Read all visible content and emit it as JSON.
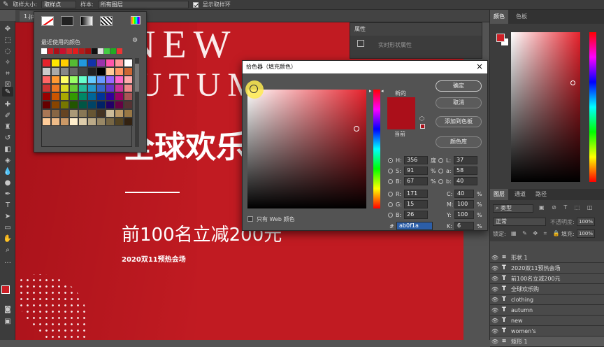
{
  "options_bar": {
    "sample_size_label": "取样大小:",
    "sample_size_value": "取样点",
    "sample_label": "样本:",
    "sample_value": "所有图层",
    "show_ring_label": "显示取样环"
  },
  "document": {
    "tab_name": "1.jpg"
  },
  "canvas": {
    "line1": "NEW",
    "line2": "AUTUMN",
    "headline": "全球欢乐购",
    "promo": "前100名立减200元",
    "event": "2020双11预热会场"
  },
  "swatches_panel": {
    "recent_label": "最近使用的颜色",
    "recent": [
      "#ffffff",
      "#cc1f26",
      "#ab0f1a",
      "#c8102e",
      "#d42a2a",
      "#e41a1c",
      "#b31b1b",
      "#a01010",
      "#111111",
      "#e0e0e0",
      "#44cc44",
      "#22aa22",
      "#ee3333"
    ],
    "grid": [
      "#e6222c",
      "#ffe600",
      "#ffcc00",
      "#55bb33",
      "#2299dd",
      "#1133aa",
      "#9933aa",
      "#ff55aa",
      "#ff9999",
      "#ffffff",
      "#cccccc",
      "#aaaaaa",
      "#888888",
      "#666666",
      "#444444",
      "#222222",
      "#000000",
      "#ffcc99",
      "#ff9966",
      "#cc6633",
      "#ff6666",
      "#ff9933",
      "#ffff66",
      "#99ff66",
      "#66ffcc",
      "#66ccff",
      "#6699ff",
      "#9966ff",
      "#ff66cc",
      "#ffaaaa",
      "#cc3333",
      "#ee7722",
      "#dddd22",
      "#66cc33",
      "#22bb99",
      "#2299cc",
      "#3366cc",
      "#6633cc",
      "#cc3399",
      "#ee8888",
      "#990000",
      "#cc5500",
      "#aaaa00",
      "#339900",
      "#008866",
      "#006699",
      "#003399",
      "#330099",
      "#990066",
      "#aa5555",
      "#660000",
      "#884400",
      "#777700",
      "#225500",
      "#005544",
      "#004466",
      "#002266",
      "#220066",
      "#660044",
      "#553333",
      "#aa7755",
      "#886644",
      "#664422",
      "#aa9977",
      "#887755",
      "#665533",
      "#443322",
      "#ccbb99",
      "#bb9966",
      "#997744",
      "#ffcc99",
      "#eebb88",
      "#cc9966",
      "#ffeecc",
      "#ddccaa",
      "#bbaa88",
      "#998866",
      "#776644",
      "#554422",
      "#332211"
    ]
  },
  "properties_panel": {
    "title": "属性",
    "subtitle": "实时形状属性"
  },
  "color_picker": {
    "title": "拾色器（填充颜色）",
    "new_label": "新的",
    "current_label": "当前",
    "new_color": "#ab0f1a",
    "current_color": "#ab0f1a",
    "buttons": {
      "ok": "确定",
      "cancel": "取消",
      "add_swatch": "添加到色板",
      "color_libraries": "颜色库"
    },
    "web_only_label": "只有 Web 颜色",
    "hsb": {
      "h_label": "H:",
      "h_value": "356",
      "h_unit": "度",
      "s_label": "S:",
      "s_value": "91",
      "s_unit": "%",
      "b_label": "B:",
      "b_value": "67",
      "b_unit": "%"
    },
    "rgb": {
      "r_label": "R:",
      "r_value": "171",
      "g_label": "G:",
      "g_value": "15",
      "b_label": "B:",
      "b_value": "26"
    },
    "lab": {
      "l_label": "L:",
      "l_value": "37",
      "a_label": "a:",
      "a_value": "58",
      "b_label": "b:",
      "b_value": "40"
    },
    "cmyk": {
      "c_label": "C:",
      "c_value": "40",
      "c_unit": "%",
      "m_label": "M:",
      "m_value": "100",
      "m_unit": "%",
      "y_label": "Y:",
      "y_value": "100",
      "y_unit": "%",
      "k_label": "K:",
      "k_value": "6",
      "k_unit": "%"
    },
    "hex_label": "#",
    "hex_value": "ab0f1a"
  },
  "color_panel": {
    "tab_color": "颜色",
    "tab_swatches": "色板",
    "foreground": "#cc1f26"
  },
  "layers_panel": {
    "tab_layers": "图层",
    "tab_channels": "通道",
    "tab_paths": "路径",
    "filter_label": "类型",
    "blend_mode": "正常",
    "opacity_label": "不透明度:",
    "opacity_value": "100%",
    "lock_label": "锁定:",
    "fill_label": "填充:",
    "fill_value": "100%",
    "layers": [
      {
        "type": "shape",
        "name": "形状 1"
      },
      {
        "type": "text",
        "name": "2020双11预热会场"
      },
      {
        "type": "text",
        "name": "前100名立减200元"
      },
      {
        "type": "text",
        "name": "全球欢乐购"
      },
      {
        "type": "text",
        "name": "clothing"
      },
      {
        "type": "text",
        "name": "autumn"
      },
      {
        "type": "text",
        "name": "new"
      },
      {
        "type": "text",
        "name": "women's"
      },
      {
        "type": "shape",
        "name": "矩形 1"
      }
    ]
  },
  "colors": {
    "accent": "#ab0f1a",
    "canvas_red": "#c11b22"
  }
}
